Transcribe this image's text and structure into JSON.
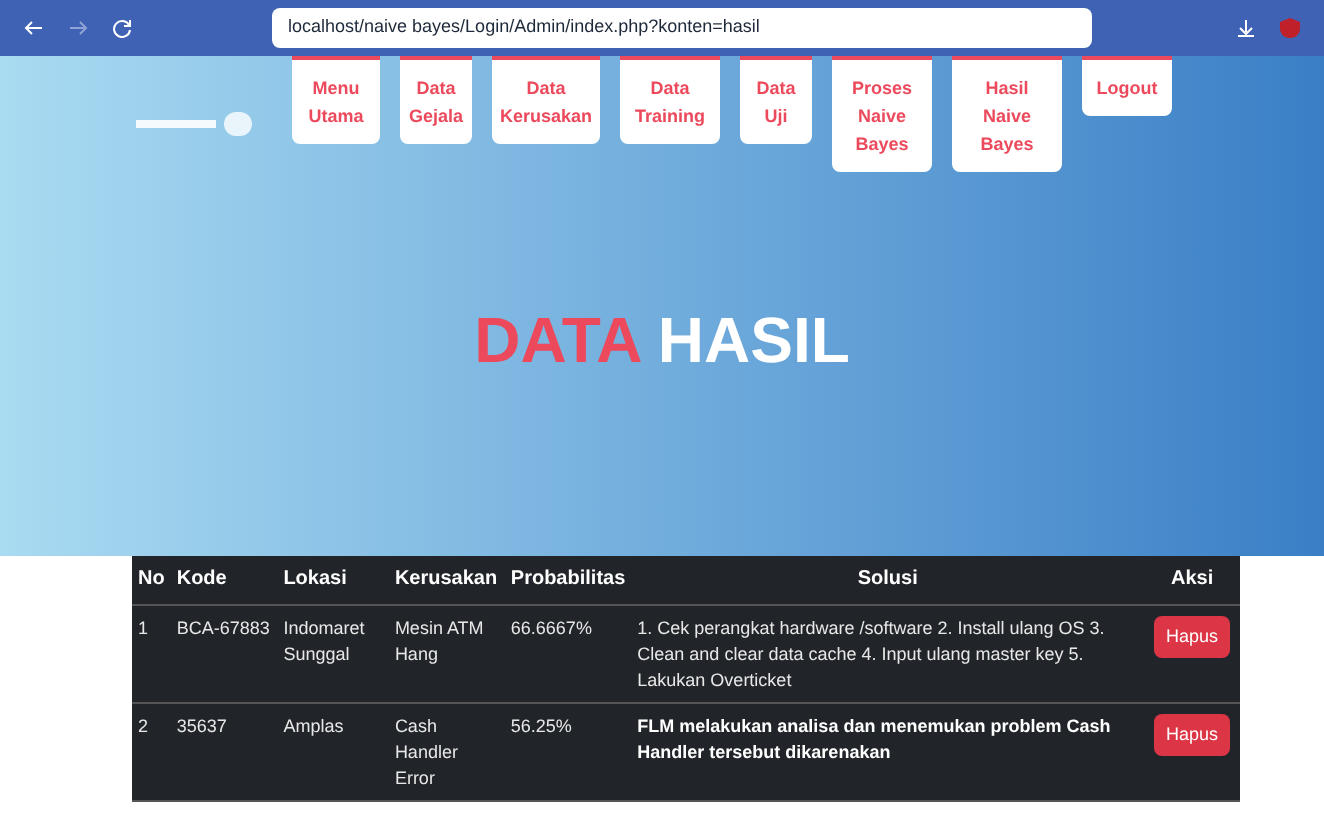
{
  "browser": {
    "url": "localhost/naive bayes/Login/Admin/index.php?konten=hasil"
  },
  "nav": [
    {
      "label": "Menu Utama"
    },
    {
      "label": "Data Gejala"
    },
    {
      "label": "Data Kerusakan"
    },
    {
      "label": "Data Training"
    },
    {
      "label": "Data Uji"
    },
    {
      "label": "Proses Naive Bayes"
    },
    {
      "label": "Hasil Naive Bayes"
    },
    {
      "label": "Logout"
    }
  ],
  "hero": {
    "title_accent": "DATA",
    "title_rest": "HASIL"
  },
  "table": {
    "columns": [
      "No",
      "Kode",
      "Lokasi",
      "Kerusakan",
      "Probabilitas",
      "Solusi",
      "Aksi"
    ],
    "rows": [
      {
        "cells": [
          "1",
          "BCA-67883",
          "Indomaret Sunggal",
          "Mesin ATM Hang",
          "66.6667%",
          "1. Cek perangkat hardware /software 2. Install ulang OS 3. Clean and clear data cache 4. Input ulang master key 5. Lakukan Overticket"
        ],
        "solution_bold": false,
        "action": "Hapus"
      },
      {
        "cells": [
          "2",
          "35637",
          "Amplas",
          "Cash Handler Error",
          "56.25%",
          "FLM melakukan analisa dan menemukan problem Cash Handler tersebut dikarenakan"
        ],
        "solution_bold": true,
        "action": "Hapus"
      }
    ]
  }
}
